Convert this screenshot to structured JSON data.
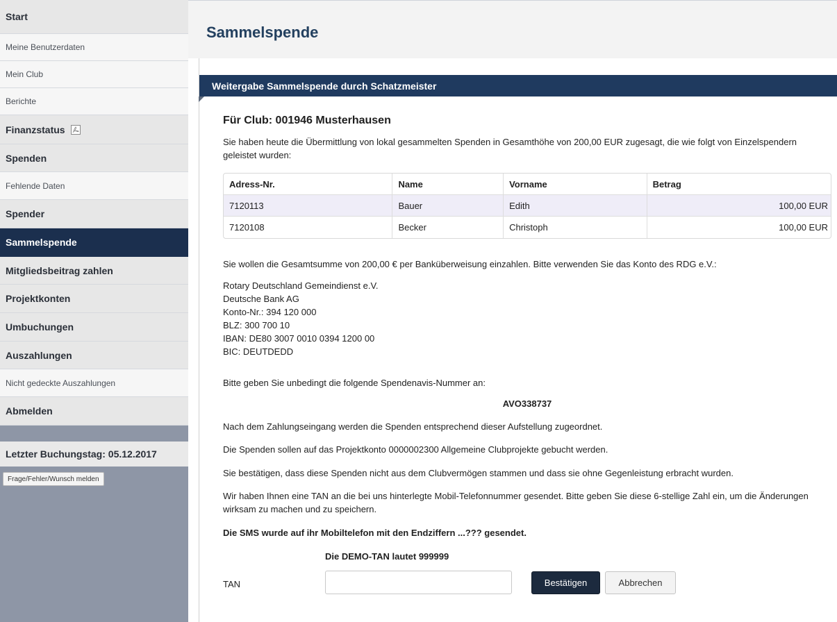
{
  "sidebar": {
    "items": [
      {
        "label": "Start"
      },
      {
        "label": "Meine Benutzerdaten"
      },
      {
        "label": "Mein Club"
      },
      {
        "label": "Berichte"
      },
      {
        "label": "Finanzstatus"
      },
      {
        "label": "Spenden"
      },
      {
        "label": "Fehlende Daten"
      },
      {
        "label": "Spender"
      },
      {
        "label": "Sammelspende"
      },
      {
        "label": "Mitgliedsbeitrag zahlen"
      },
      {
        "label": "Projektkonten"
      },
      {
        "label": "Umbuchungen"
      },
      {
        "label": "Auszahlungen"
      },
      {
        "label": "Nicht gedeckte Auszahlungen"
      },
      {
        "label": "Abmelden"
      }
    ],
    "last_booking_day": "Letzter Buchungstag: 05.12.2017",
    "feedback_button": "Frage/Fehler/Wunsch melden",
    "icons": {
      "finanzstatus": "pdf-icon"
    }
  },
  "main": {
    "page_title": "Sammelspende",
    "panel_title": "Weitergabe Sammelspende durch Schatzmeister",
    "club_heading": "Für Club: 001946 Musterhausen",
    "intro": "Sie haben heute die Übermittlung von lokal gesammelten Spenden in Gesamthöhe von 200,00 EUR zugesagt, die wie folgt von Einzelspendern geleistet wurden:",
    "table": {
      "headers": [
        "Adress-Nr.",
        "Name",
        "Vorname",
        "Betrag"
      ],
      "rows": [
        [
          "7120113",
          "Bauer",
          "Edith",
          "100,00 EUR"
        ],
        [
          "7120108",
          "Becker",
          "Christoph",
          "100,00 EUR"
        ]
      ]
    },
    "payment_note": "Sie wollen die Gesamtsumme von 200,00 € per Banküberweisung einzahlen. Bitte verwenden Sie das Konto des RDG e.V.:",
    "bank": {
      "line1": "Rotary Deutschland Gemeindienst e.V.",
      "line2": "Deutsche Bank AG",
      "line3": "Konto-Nr.: 394 120 000",
      "line4": "BLZ: 300 700 10",
      "line5": "IBAN: DE80 3007 0010 0394 1200 00",
      "line6": "BIC: DEUTDEDD"
    },
    "avis_instruction": "Bitte geben Sie unbedingt die folgende Spendenavis-Nummer an:",
    "avis_number": "AVO338737",
    "assignment_note": "Nach dem Zahlungseingang werden die Spenden entsprechend dieser Aufstellung zugeordnet.",
    "project_note": "Die Spenden sollen auf das Projektkonto 0000002300 Allgemeine Clubprojekte gebucht werden.",
    "confirmation_note": "Sie bestätigen, dass diese Spenden nicht aus dem Clubvermögen stammen und dass sie ohne Gegenleistung erbracht wurden.",
    "tan_note": "Wir haben Ihnen eine TAN an die bei uns hinterlegte Mobil-Telefonnummer gesendet. Bitte geben Sie diese 6-stellige Zahl ein, um die Änderungen wirksam zu machen und zu speichern.",
    "sms_note": "Die SMS wurde auf ihr Mobiltelefon mit den Endziffern ...??? gesendet.",
    "demo_tan": "Die DEMO-TAN lautet 999999",
    "tan_label": "TAN",
    "tan_value": "",
    "confirm_label": "Bestätigen",
    "cancel_label": "Abbrechen"
  },
  "colors": {
    "nav_active": "#1b2f4e",
    "panel_header": "#1f3a5f",
    "title": "#23405f",
    "sidebar_bg": "#8e96a6"
  }
}
